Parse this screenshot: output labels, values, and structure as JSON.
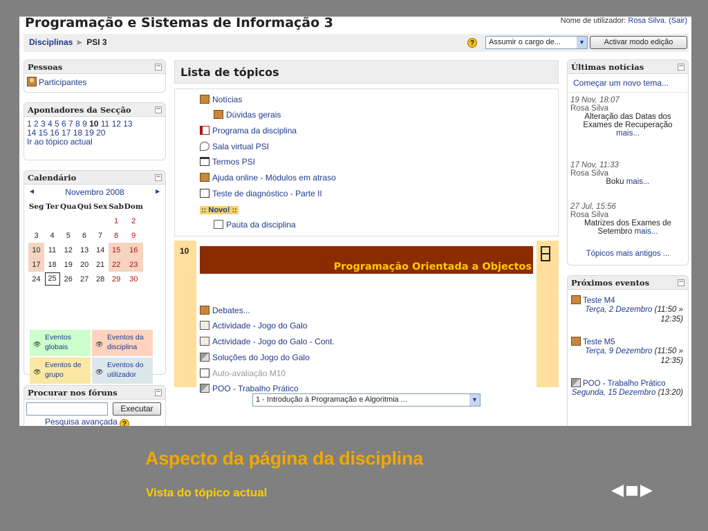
{
  "page": {
    "title": "Programação e Sistemas de Informação 3",
    "user_label": "Nome de utilizador:",
    "user_name": "Rosa Silva.",
    "logout": "(Sair)"
  },
  "navbar": {
    "breadcrumb_root": "Disciplinas",
    "breadcrumb_sep": "►",
    "breadcrumb_current": "PSI 3",
    "help_icon": "?",
    "role_select": "Assumir o cargo de...",
    "edit_button": "Activar modo edição"
  },
  "blocks": {
    "people": {
      "title": "Pessoas",
      "participants": "Participantes"
    },
    "section_links": {
      "title": "Apontadores da Secção",
      "line1_pre": "1 2 3 4 5 6 7 8 9 ",
      "line1_current": "10",
      "line1_post": " 11 12 13",
      "line2": "14 15 16 17 18 19 20",
      "line3": "Ir ao tópico actual"
    },
    "calendar": {
      "title": "Calendário",
      "month": "Novembro 2008",
      "prev": "◄",
      "next": "►",
      "weekdays": [
        "Seg",
        "Ter",
        "Qua",
        "Qui",
        "Sex",
        "Sab",
        "Dom"
      ],
      "weeks": [
        [
          "",
          "",
          "",
          "",
          "",
          "1",
          "2"
        ],
        [
          "3",
          "4",
          "5",
          "6",
          "7",
          "8",
          "9"
        ],
        [
          "10",
          "11",
          "12",
          "13",
          "14",
          "15",
          "16"
        ],
        [
          "17",
          "18",
          "19",
          "20",
          "21",
          "22",
          "23"
        ],
        [
          "24",
          "25",
          "26",
          "27",
          "28",
          "29",
          "30"
        ]
      ],
      "today": "25",
      "event_days": [
        "10",
        "15",
        "16",
        "17",
        "22",
        "23"
      ],
      "legend": {
        "global": "Eventos globais",
        "course": "Eventos da disciplina",
        "group": "Eventos de grupo",
        "user": "Eventos do utilizador"
      },
      "colors": {
        "global": "#ccffcc",
        "course": "#ffd3bd",
        "group": "#fbe8a4",
        "user": "#dce7ec"
      }
    },
    "forum_search": {
      "title": "Procurar nos fóruns",
      "button": "Executar",
      "advanced": "Pesquisa avançada"
    },
    "news": {
      "title": "Últimas notícias",
      "new_topic": "Começar um novo tema...",
      "items": [
        {
          "date": "19 Nov, 18:07",
          "author": "Rosa Silva",
          "text": "Alteração das Datas dos Exames de Recuperação",
          "more": "mais..."
        },
        {
          "date": "17 Nov, 11:33",
          "author": "Rosa Silva",
          "text": "Boku",
          "more": "mais..."
        },
        {
          "date": "27 Jul, 15:56",
          "author": "Rosa Silva",
          "text": "Matrizes dos Exames de Setembro",
          "more": "mais..."
        }
      ],
      "older": "Tópicos mais antigos ..."
    },
    "events": {
      "title": "Próximos eventos",
      "items": [
        {
          "name": "Teste M4",
          "date": "Terça, 2 Dezembro",
          "time": "(11:50 » 12:35)"
        },
        {
          "name": "Teste M5",
          "date": "Terça, 9 Dezembro",
          "time": "(11:50 » 12:35)"
        },
        {
          "name": "POO - Trabalho Prático",
          "date": "Segunda, 15 Dezembro",
          "time": "(13:20)"
        }
      ]
    }
  },
  "main": {
    "heading": "Lista de tópicos",
    "section0": [
      {
        "label": "Notícias",
        "icon": "forum-icon"
      },
      {
        "label": "Dúvidas gerais",
        "icon": "forum-icon"
      },
      {
        "label": "Programa da disciplina",
        "icon": "pdf-icon"
      },
      {
        "label": "Sala virtual PSI",
        "icon": "chat-icon"
      },
      {
        "label": "Termos PSI",
        "icon": "glossary-icon"
      },
      {
        "label": "Ajuda online - Módulos em atraso",
        "icon": "forum-icon"
      },
      {
        "label": "Teste de diagnóstico - Parte II",
        "icon": "quiz-icon"
      }
    ],
    "novo_label": ":: Novo! ::",
    "novo_item": "Pauta da disciplina",
    "section10": {
      "number": "10",
      "banner": "Programação Orientada a Objectos",
      "activities": [
        {
          "label": "Debates...",
          "icon": "forum-icon"
        },
        {
          "label": "Actividade - Jogo do Galo",
          "icon": "assignment-icon"
        },
        {
          "label": "Actividade - Jogo do Galo - Cont.",
          "icon": "assignment-icon"
        },
        {
          "label": "Soluções do Jogo do Galo",
          "icon": "upload-icon"
        },
        {
          "label": "Auto-avaliação M10",
          "icon": "quiz-icon",
          "dimmed": true
        },
        {
          "label": "POO - Trabalho Prático",
          "icon": "upload-icon"
        }
      ]
    },
    "jump_select": "1 - Introdução à Programação e Algoritmia ..."
  },
  "slide": {
    "title": "Aspecto da página da disciplina",
    "subtitle": "Vista do tópico actual"
  }
}
